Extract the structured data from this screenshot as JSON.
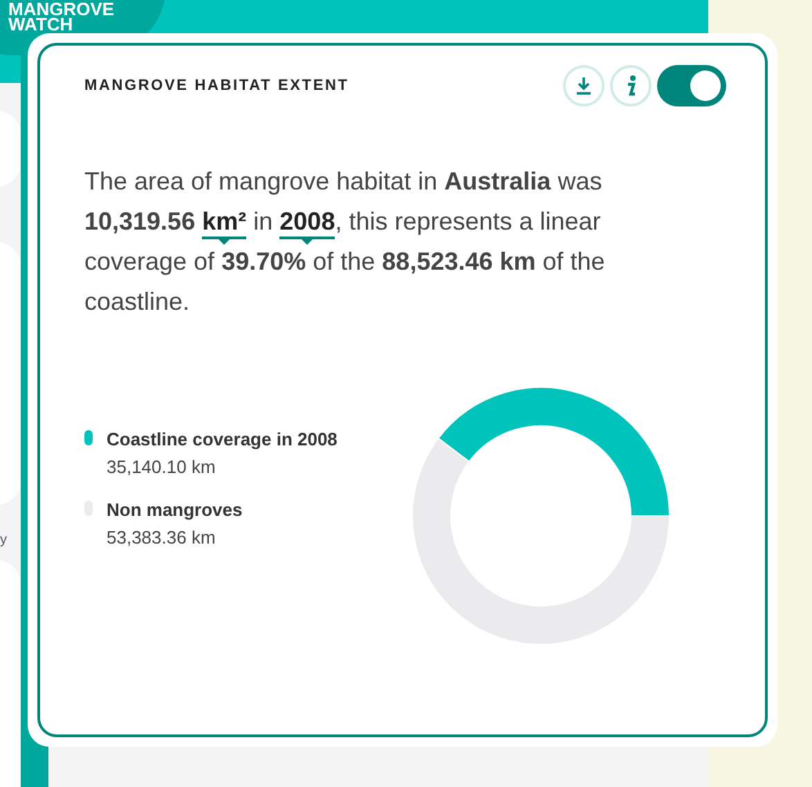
{
  "logo": {
    "lines": [
      "MANGROVE",
      "WATCH"
    ]
  },
  "sidebar_fragment": "y",
  "widget": {
    "title": "MANGROVE HABITAT EXTENT",
    "toggle_on": true,
    "summary": {
      "before": "The area of mangrove habitat in **Australia** was **10,319.56**",
      "unit": "km²",
      "middle": "in",
      "year": "2008",
      "after": ", this represents a linear coverage of **39.70%** of the **88,523.46 km** of the coastline."
    },
    "legend": [
      {
        "label": "Coastline coverage in 2008",
        "value": "35,140.10 km",
        "color": "#00c3bc"
      },
      {
        "label": "Non mangroves",
        "value": "53,383.36 km",
        "color": "#ebebee"
      }
    ],
    "chart_data": {
      "type": "donut",
      "values": [
        39.7,
        60.3
      ]
    }
  }
}
